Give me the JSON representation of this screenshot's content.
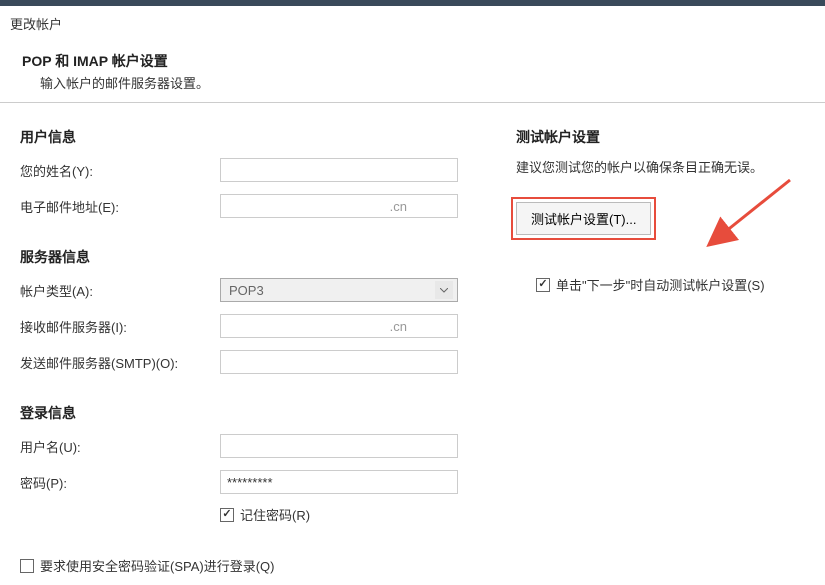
{
  "window": {
    "title": "更改帐户"
  },
  "subheader": {
    "title": "POP 和 IMAP 帐户设置",
    "desc": "输入帐户的邮件服务器设置。"
  },
  "sections": {
    "userInfo": "用户信息",
    "serverInfo": "服务器信息",
    "loginInfo": "登录信息",
    "testSettings": "测试帐户设置"
  },
  "labels": {
    "yourName": "您的姓名(Y):",
    "email": "电子邮件地址(E):",
    "accountType": "帐户类型(A):",
    "incomingServer": "接收邮件服务器(I):",
    "outgoingServer": "发送邮件服务器(SMTP)(O):",
    "username": "用户名(U):",
    "password": "密码(P):",
    "rememberPassword": "记住密码(R)",
    "spaAuth": "要求使用安全密码验证(SPA)进行登录(Q)",
    "testDesc": "建议您测试您的帐户以确保条目正确无误。",
    "testButton": "测试帐户设置(T)...",
    "autoTest": "单击\"下一步\"时自动测试帐户设置(S)"
  },
  "values": {
    "yourName": "",
    "email": ".cn",
    "accountType": "POP3",
    "incomingServer": ".cn",
    "outgoingServer": "",
    "username": "",
    "password": "*********"
  },
  "checkboxes": {
    "rememberPassword": true,
    "spaAuth": false,
    "autoTest": true
  }
}
